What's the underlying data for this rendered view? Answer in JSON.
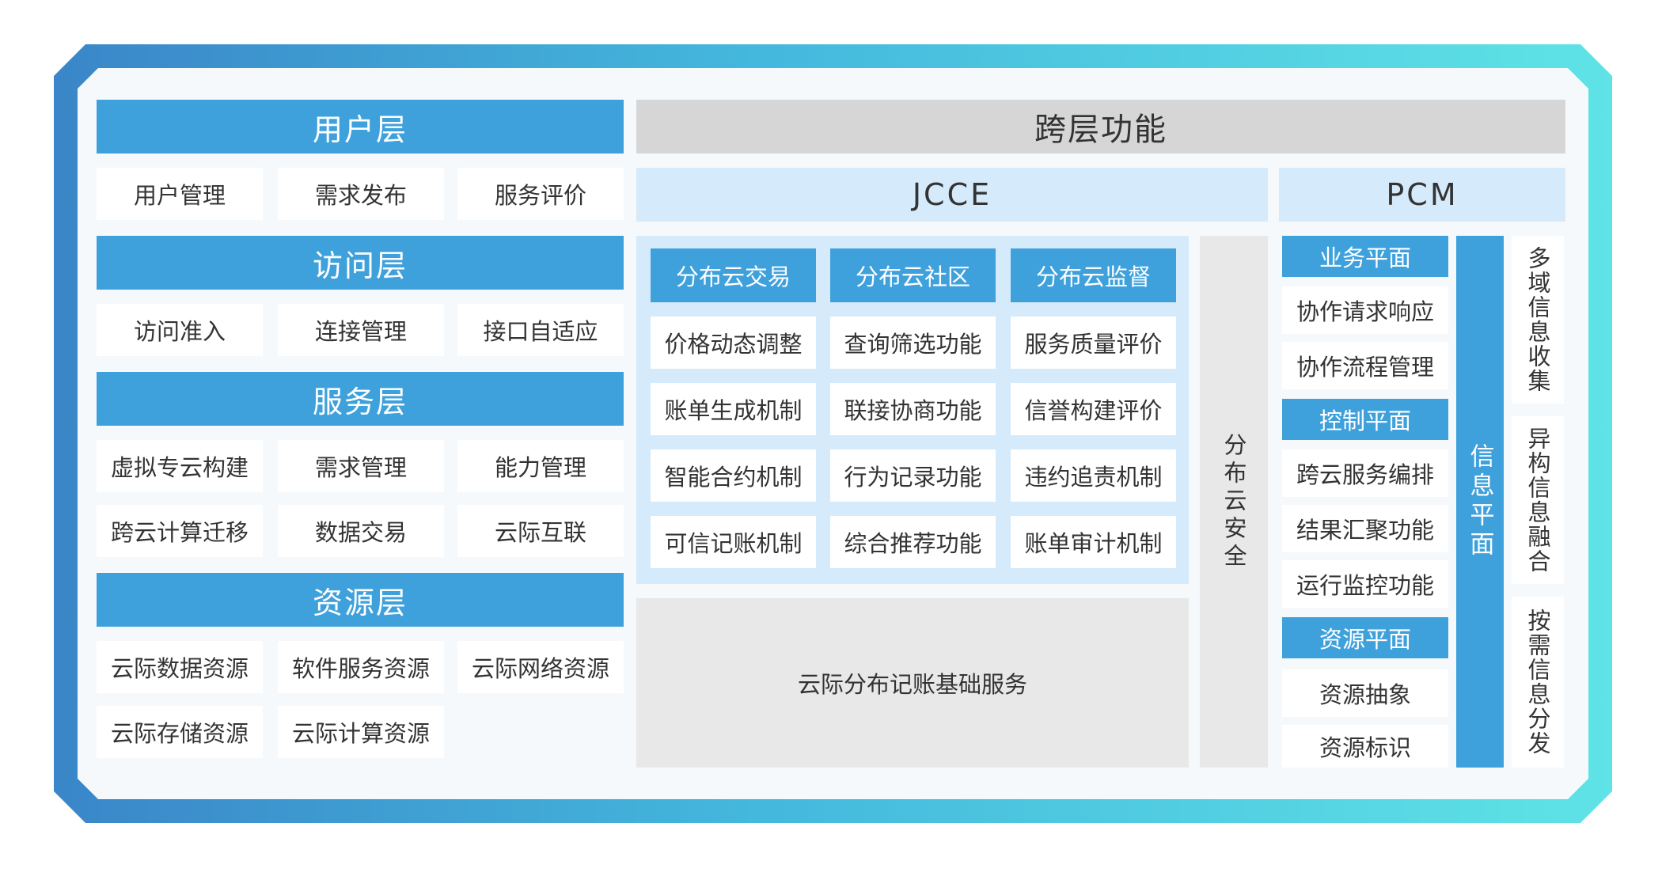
{
  "left": {
    "user_layer": {
      "title": "用户层",
      "items": [
        "用户管理",
        "需求发布",
        "服务评价"
      ]
    },
    "access_layer": {
      "title": "访问层",
      "items": [
        "访问准入",
        "连接管理",
        "接口自适应"
      ]
    },
    "service_layer": {
      "title": "服务层",
      "items": [
        "虚拟专云构建",
        "需求管理",
        "能力管理",
        "跨云计算迁移",
        "数据交易",
        "云际互联"
      ]
    },
    "resource_layer": {
      "title": "资源层",
      "items": [
        "云际数据资源",
        "软件服务资源",
        "云际网络资源",
        "云际存储资源",
        "云际计算资源"
      ]
    }
  },
  "cross": {
    "title": "跨层功能",
    "jcce": {
      "title": "JCCE",
      "columns": [
        {
          "title": "分布云交易",
          "items": [
            "价格动态调整",
            "账单生成机制",
            "智能合约机制",
            "可信记账机制"
          ]
        },
        {
          "title": "分布云社区",
          "items": [
            "查询筛选功能",
            "联接协商功能",
            "行为记录功能",
            "综合推荐功能"
          ]
        },
        {
          "title": "分布云监督",
          "items": [
            "服务质量评价",
            "信誉构建评价",
            "违约追责机制",
            "账单审计机制"
          ]
        }
      ],
      "base_service": "云际分布记账基础服务",
      "security": "分布云安全"
    },
    "pcm": {
      "title": "PCM",
      "business_plane": {
        "title": "业务平面",
        "items": [
          "协作请求响应",
          "协作流程管理"
        ]
      },
      "control_plane": {
        "title": "控制平面",
        "items": [
          "跨云服务编排",
          "结果汇聚功能",
          "运行监控功能"
        ]
      },
      "resource_plane": {
        "title": "资源平面",
        "items": [
          "资源抽象",
          "资源标识"
        ]
      },
      "info_plane": "信息平面",
      "info_functions": [
        "多域信息收集",
        "异构信息融合",
        "按需信息分发"
      ]
    }
  }
}
